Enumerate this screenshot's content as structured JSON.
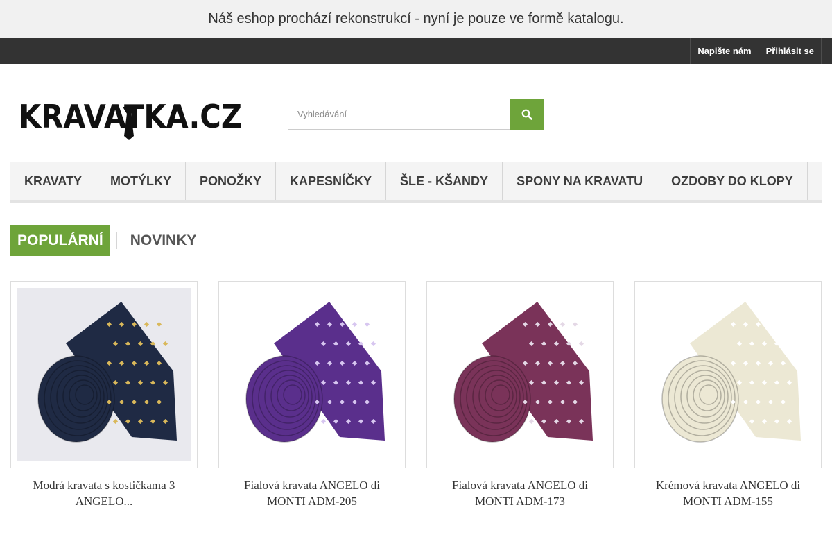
{
  "notice": {
    "text": "Náš eshop prochází rekonstrukcí - nyní je pouze ve formě katalogu."
  },
  "topbar": {
    "links": [
      {
        "label": "Napište nám"
      },
      {
        "label": "Přihlásit se"
      }
    ]
  },
  "header": {
    "logo_text": "KRAVATKA.CZ",
    "search": {
      "placeholder": "Vyhledávání",
      "icon": "search-icon"
    }
  },
  "nav": {
    "items": [
      {
        "label": "KRAVATY"
      },
      {
        "label": "MOTÝLKY"
      },
      {
        "label": "PONOŽKY"
      },
      {
        "label": "KAPESNÍČKY"
      },
      {
        "label": "ŠLE - KŠANDY"
      },
      {
        "label": "SPONY NA KRAVATU"
      },
      {
        "label": "OZDOBY DO KLOPY"
      }
    ]
  },
  "tabs": {
    "items": [
      {
        "label": "POPULÁRNÍ",
        "active": true
      },
      {
        "label": "NOVINKY",
        "active": false
      }
    ]
  },
  "colors": {
    "accent": "#6ea43a",
    "topbar": "#333333",
    "notice_bg": "#f1f1f1"
  },
  "products": [
    {
      "title": "Modrá kravata s kostičkama 3 ANGELO...",
      "tie_color": "#1f2a44",
      "pattern_color": "#d9b85a",
      "bg": "#e9e9ee"
    },
    {
      "title": "Fialová kravata ANGELO di MONTI ADM-205",
      "tie_color": "#5a2f8c",
      "pattern_color": "#d7c6f0",
      "bg": "#ffffff"
    },
    {
      "title": "Fialová kravata ANGELO di MONTI ADM-173",
      "tie_color": "#7a3359",
      "pattern_color": "#e4d8e6",
      "bg": "#ffffff"
    },
    {
      "title": "Krémová kravata ANGELO di MONTI ADM-155",
      "tie_color": "#ece8d4",
      "pattern_color": "#ffffff",
      "bg": "#ffffff"
    }
  ]
}
